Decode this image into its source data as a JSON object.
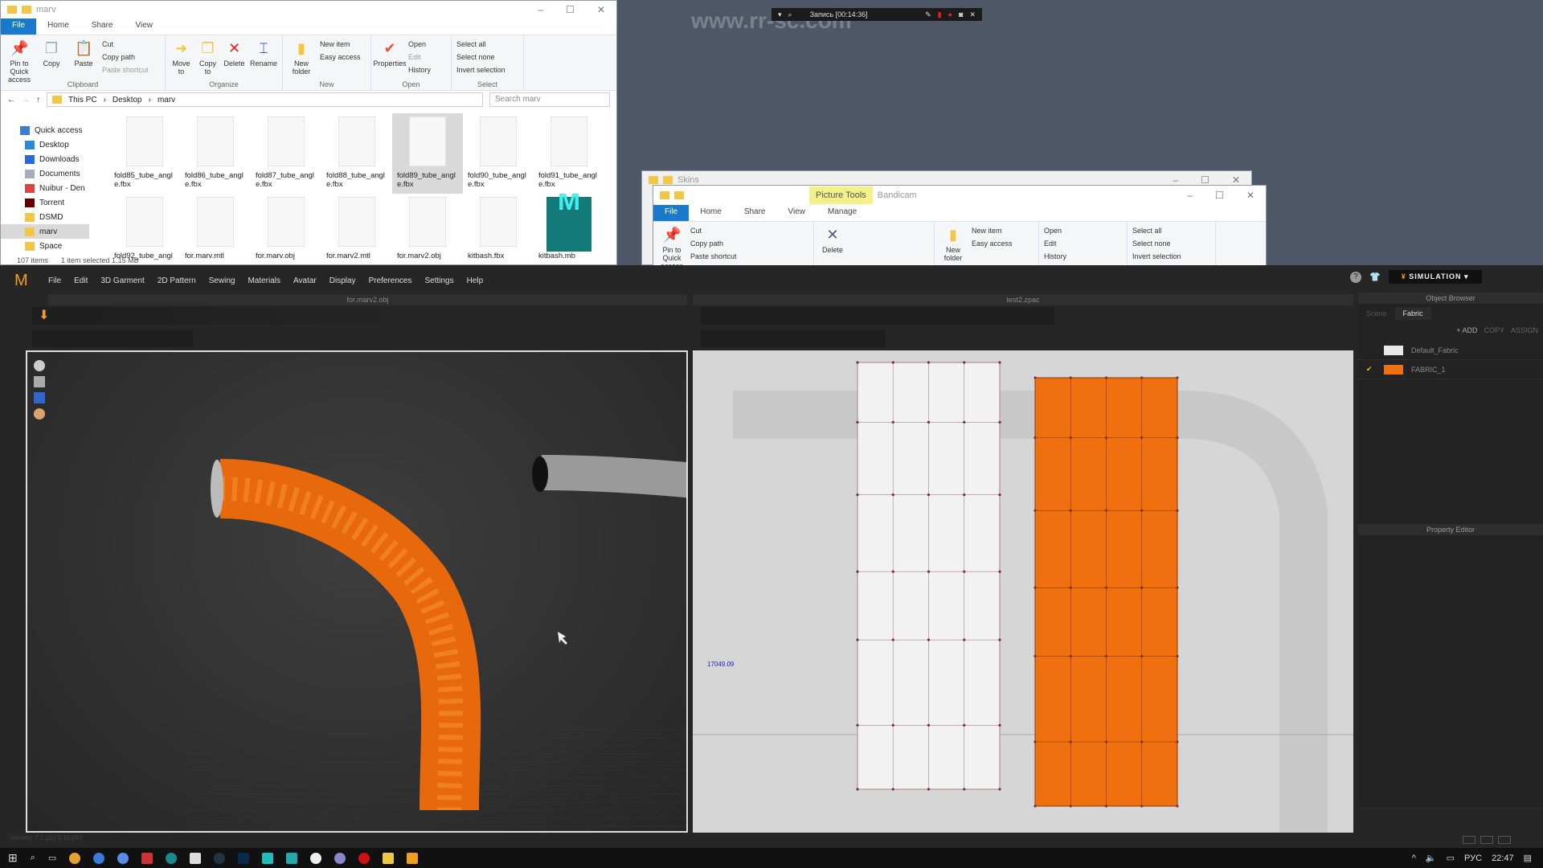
{
  "watermark": "www.rr-sc.com",
  "bandicam": {
    "text": "Запись [00:14:36]"
  },
  "explorer": {
    "title": "marv",
    "tabs": [
      "File",
      "Home",
      "Share",
      "View"
    ],
    "clipboard": {
      "pin": "Pin to Quick access",
      "copy": "Copy",
      "paste": "Paste",
      "cut": "Cut",
      "copy_path": "Copy path",
      "paste_shortcut": "Paste shortcut",
      "label": "Clipboard"
    },
    "organize": {
      "move": "Move to",
      "copy": "Copy to",
      "delete": "Delete",
      "rename": "Rename",
      "label": "Organize"
    },
    "new": {
      "folder": "New folder",
      "item": "New item",
      "easy": "Easy access",
      "label": "New"
    },
    "open": {
      "properties": "Properties",
      "open": "Open",
      "edit": "Edit",
      "history": "History",
      "label": "Open"
    },
    "select": {
      "all": "Select all",
      "none": "Select none",
      "invert": "Invert selection",
      "label": "Select"
    },
    "breadcrumb": [
      "This PC",
      "Desktop",
      "marv"
    ],
    "search_placeholder": "Search marv",
    "nav": [
      {
        "label": "Quick access",
        "color": "#3a7bd5"
      },
      {
        "label": "Desktop",
        "color": "#2a8ad8"
      },
      {
        "label": "Downloads",
        "color": "#2a6ad8"
      },
      {
        "label": "Documents",
        "color": "#aab"
      },
      {
        "label": "Nuibur - Den",
        "color": "#d44"
      },
      {
        "label": "Torrent",
        "color": "#600"
      },
      {
        "label": "DSMD",
        "color": "#f2c744"
      },
      {
        "label": "marv",
        "color": "#f2c744"
      },
      {
        "label": "Space",
        "color": "#f2c744"
      }
    ],
    "files": [
      "fold85_tube_angle.fbx",
      "fold86_tube_angle.fbx",
      "fold87_tube_angle.fbx",
      "fold88_tube_angle.fbx",
      "fold89_tube_angle.fbx",
      "fold90_tube_angle.fbx",
      "fold91_tube_angle.fbx",
      "fold92_tube_angl",
      "for.marv.mtl",
      "for.marv.obj",
      "for.marv2.mtl",
      "for.marv2.obj",
      "kitbash.fbx",
      "kitbash.mb"
    ],
    "status": {
      "items": "107 items",
      "selected": "1 item selected  1.15 MB"
    }
  },
  "skins": {
    "title": "Skins",
    "context_tab": "Picture Tools",
    "app": "Bandicam",
    "tabs": [
      "File",
      "Home",
      "Share",
      "View",
      "Manage"
    ]
  },
  "md": {
    "menu": [
      "File",
      "Edit",
      "3D Garment",
      "2D Pattern",
      "Sewing",
      "Materials",
      "Avatar",
      "Display",
      "Preferences",
      "Settings",
      "Help"
    ],
    "view3d_title": "for.marv2.obj",
    "view2d_title": "test2.zpac",
    "measure": "17049.09",
    "mode": "SIMULATION",
    "version": "Version: 7.1.110    0.15 [00]",
    "object_browser": {
      "title": "Object Browser",
      "tabs": [
        "Scene",
        "Fabric"
      ],
      "add": "+ ADD",
      "copy": "COPY",
      "assign": "ASSIGN",
      "fabrics": [
        {
          "name": "Default_Fabric",
          "color": "#e8e8e8",
          "checked": false
        },
        {
          "name": "FABRIC_1",
          "color": "#f07010",
          "checked": true
        }
      ]
    },
    "property_editor": "Property Editor",
    "fabric_color": "#f07010"
  },
  "taskbar": {
    "lang": "РУС",
    "time": "22:47"
  }
}
